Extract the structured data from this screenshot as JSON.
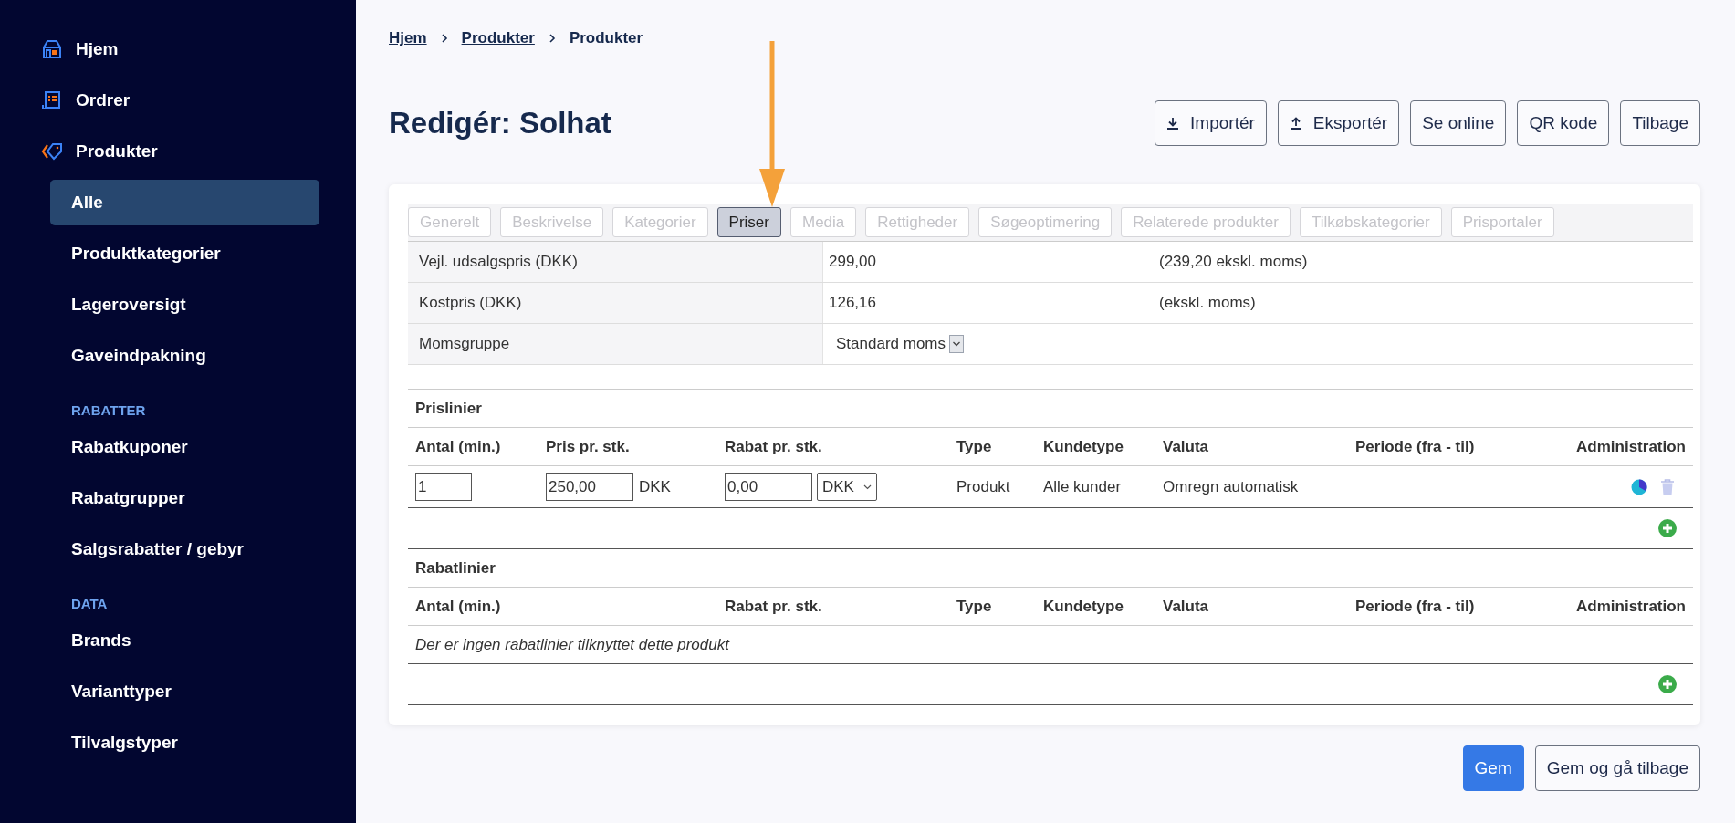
{
  "sidebar": {
    "items": [
      {
        "kind": "main",
        "label": "Hjem",
        "selected": false
      },
      {
        "kind": "main",
        "label": "Ordrer",
        "selected": false
      },
      {
        "kind": "main",
        "label": "Produkter",
        "selected": false
      },
      {
        "kind": "sub",
        "label": "Alle",
        "selected": true
      },
      {
        "kind": "sub",
        "label": "Produktkategorier",
        "selected": false
      },
      {
        "kind": "sub",
        "label": "Lageroversigt",
        "selected": false
      },
      {
        "kind": "sub",
        "label": "Gaveindpakning",
        "selected": false
      },
      {
        "kind": "heading",
        "label": "RABATTER"
      },
      {
        "kind": "sub",
        "label": "Rabatkuponer",
        "selected": false
      },
      {
        "kind": "sub",
        "label": "Rabatgrupper",
        "selected": false
      },
      {
        "kind": "sub",
        "label": "Salgsrabatter / gebyr",
        "selected": false
      },
      {
        "kind": "heading",
        "label": "DATA"
      },
      {
        "kind": "sub",
        "label": "Brands",
        "selected": false
      },
      {
        "kind": "sub",
        "label": "Varianttyper",
        "selected": false
      },
      {
        "kind": "sub",
        "label": "Tilvalgstyper",
        "selected": false
      }
    ]
  },
  "breadcrumb": [
    {
      "label": "Hjem",
      "kind": "link"
    },
    {
      "label": "Produkter",
      "kind": "link"
    },
    {
      "label": "Produkter",
      "kind": "current"
    }
  ],
  "page_title": "Redigér: Solhat",
  "header_buttons": [
    {
      "label": "Importér",
      "kind": "import"
    },
    {
      "label": "Eksportér",
      "kind": "export"
    },
    {
      "label": "Se online",
      "kind": "plain"
    },
    {
      "label": "QR kode",
      "kind": "plain"
    },
    {
      "label": "Tilbage",
      "kind": "plain"
    }
  ],
  "tabs": [
    {
      "label": "Generelt",
      "selected": false
    },
    {
      "label": "Beskrivelse",
      "selected": false
    },
    {
      "label": "Kategorier",
      "selected": false
    },
    {
      "label": "Priser",
      "selected": true
    },
    {
      "label": "Media",
      "selected": false
    },
    {
      "label": "Rettigheder",
      "selected": false
    },
    {
      "label": "Søgeoptimering",
      "selected": false
    },
    {
      "label": "Relaterede produkter",
      "selected": false
    },
    {
      "label": "Tilkøbskategorier",
      "selected": false
    },
    {
      "label": "Prisportaler",
      "selected": false
    }
  ],
  "info_rows": [
    {
      "kind": "text",
      "label": "Vejl. udsalgspris (DKK)",
      "value": "299,00",
      "note": "(239,20 ekskl. moms)"
    },
    {
      "kind": "text",
      "label": "Kostpris (DKK)",
      "value": "126,16",
      "note": "(ekskl. moms)"
    },
    {
      "kind": "select",
      "label": "Momsgruppe",
      "value": "Standard moms"
    }
  ],
  "prislinier": {
    "title": "Prislinier",
    "columns": [
      {
        "kind": "antal",
        "label": "Antal (min.)"
      },
      {
        "kind": "pris",
        "label": "Pris pr. stk."
      },
      {
        "kind": "rabat",
        "label": "Rabat pr. stk."
      },
      {
        "kind": "type",
        "label": "Type"
      },
      {
        "kind": "kundetype",
        "label": "Kundetype"
      },
      {
        "kind": "valuta",
        "label": "Valuta"
      },
      {
        "kind": "periode",
        "label": "Periode (fra - til)"
      },
      {
        "kind": "admin",
        "label": "Administration"
      }
    ],
    "rows": [
      {
        "antal": "1",
        "pris": "250,00",
        "pris_currency": "DKK",
        "rabat": "0,00",
        "rabat_currency": "DKK",
        "type": "Produkt",
        "kundetype": "Alle kunder",
        "valuta": "Omregn automatisk"
      }
    ]
  },
  "rabatlinier": {
    "title": "Rabatlinier",
    "columns": [
      {
        "kind": "antal",
        "label": "Antal (min.)"
      },
      {
        "kind": "rabat",
        "label": "Rabat pr. stk."
      },
      {
        "kind": "type",
        "label": "Type"
      },
      {
        "kind": "kundetype",
        "label": "Kundetype"
      },
      {
        "kind": "valuta",
        "label": "Valuta"
      },
      {
        "kind": "periode",
        "label": "Periode (fra - til)"
      },
      {
        "kind": "admin",
        "label": "Administration"
      }
    ],
    "empty_message": "Der er ingen rabatlinier tilknyttet dette produkt"
  },
  "footer_buttons": [
    {
      "label": "Gem",
      "kind": "primary"
    },
    {
      "label": "Gem og gå tilbage",
      "kind": "secondary"
    }
  ]
}
